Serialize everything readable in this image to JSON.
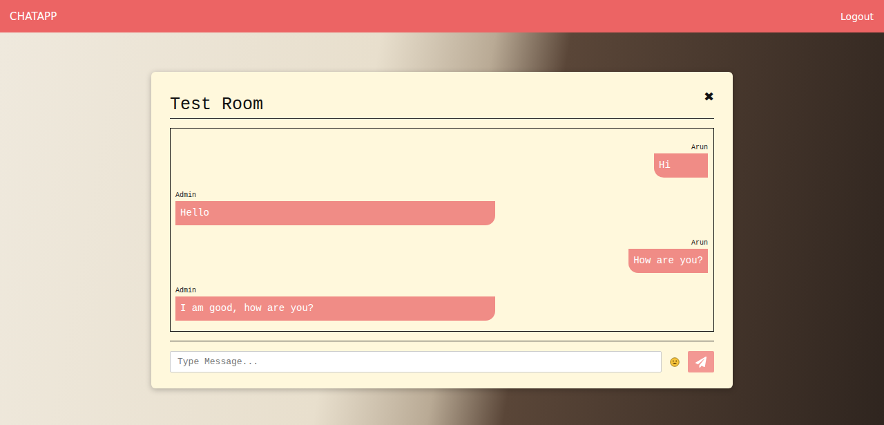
{
  "navbar": {
    "brand": "CHATAPP",
    "logout": "Logout"
  },
  "room": {
    "title": "Test Room",
    "close": "✖"
  },
  "messages": [
    {
      "sender": "Arun",
      "text": "Hi",
      "kind": "outgoing"
    },
    {
      "sender": "Admin",
      "text": "Hello",
      "kind": "incoming"
    },
    {
      "sender": "Arun",
      "text": "How are you?",
      "kind": "outgoing"
    },
    {
      "sender": "Admin",
      "text": "I am good, how are you?",
      "kind": "incoming"
    }
  ],
  "composer": {
    "placeholder": "Type Message..."
  }
}
